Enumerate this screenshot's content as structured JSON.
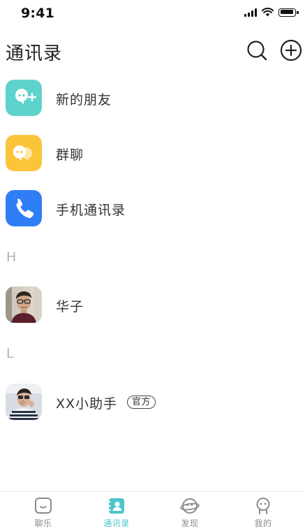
{
  "status_bar": {
    "time": "9:41",
    "icons": [
      "cellular-signal-icon",
      "wifi-icon",
      "battery-icon"
    ]
  },
  "header": {
    "title": "通讯录",
    "actions": [
      "search-icon",
      "add-circle-icon"
    ]
  },
  "entries": [
    {
      "label": "新的朋友",
      "icon": "add-friend-icon",
      "color": "#5dd3cc"
    },
    {
      "label": "群聊",
      "icon": "group-chat-icon",
      "color": "#fbc53a"
    },
    {
      "label": "手机通讯录",
      "icon": "phone-icon",
      "color": "#2f7ef5"
    }
  ],
  "sections": [
    {
      "letter": "H",
      "contacts": [
        {
          "name": "华子",
          "avatar": "contact-photo"
        }
      ]
    },
    {
      "letter": "L",
      "contacts": [
        {
          "name": "XX小助手",
          "badge": "官方",
          "avatar": "contact-photo"
        }
      ]
    }
  ],
  "tab_bar": {
    "active_color": "#4cc5c9",
    "inactive_color": "#8a8a8a",
    "tabs": [
      {
        "label": "聊乐",
        "icon": "chat-icon",
        "active": false
      },
      {
        "label": "通讯录",
        "icon": "contacts-icon",
        "active": true
      },
      {
        "label": "发现",
        "icon": "discover-icon",
        "active": false
      },
      {
        "label": "我的",
        "icon": "profile-icon",
        "active": false
      }
    ]
  }
}
